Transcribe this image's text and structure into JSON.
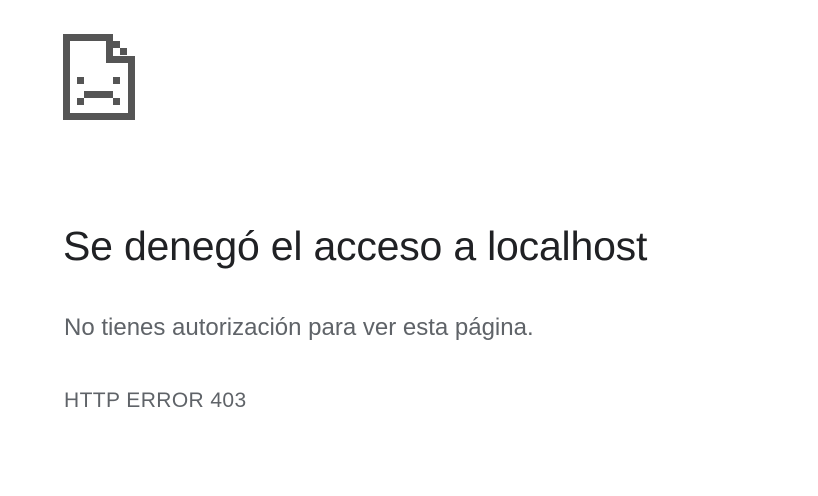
{
  "icon": {
    "name": "sad-page-icon",
    "color": "#555555"
  },
  "heading": "Se denegó el acceso a localhost",
  "message": "No tienes autorización para ver esta página.",
  "error_code": "HTTP ERROR 403",
  "colors": {
    "heading": "#202124",
    "secondary_text": "#5f6368",
    "background": "#ffffff"
  }
}
